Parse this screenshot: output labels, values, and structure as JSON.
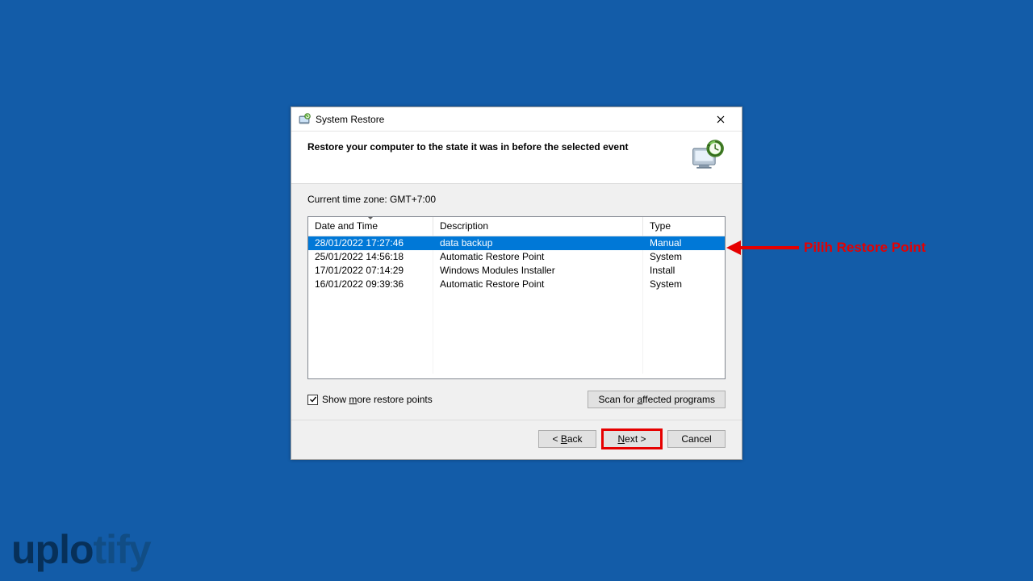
{
  "window": {
    "title": "System Restore"
  },
  "header": {
    "instruction": "Restore your computer to the state it was in before the selected event"
  },
  "content": {
    "timezone_label": "Current time zone: GMT+7:00",
    "columns": {
      "date": "Date and Time",
      "desc": "Description",
      "type": "Type"
    },
    "rows": [
      {
        "date": "28/01/2022 17:27:46",
        "desc": "data backup",
        "type": "Manual",
        "selected": true
      },
      {
        "date": "25/01/2022 14:56:18",
        "desc": "Automatic Restore Point",
        "type": "System",
        "selected": false
      },
      {
        "date": "17/01/2022 07:14:29",
        "desc": "Windows Modules Installer",
        "type": "Install",
        "selected": false
      },
      {
        "date": "16/01/2022 09:39:36",
        "desc": "Automatic Restore Point",
        "type": "System",
        "selected": false
      }
    ],
    "show_more": {
      "checked": true,
      "prefix": "Show ",
      "underlined": "m",
      "suffix": "ore restore points"
    },
    "scan_button": {
      "prefix": "Scan for ",
      "underlined": "a",
      "suffix": "ffected programs"
    }
  },
  "footer": {
    "back": {
      "prefix": "< ",
      "underlined": "B",
      "suffix": "ack"
    },
    "next": {
      "underlined": "N",
      "suffix": "ext >"
    },
    "cancel": "Cancel"
  },
  "annotations": {
    "arrow_label": "Pilih Restore Point",
    "highlight_color": "#e60000"
  },
  "watermark": {
    "part1": "uplo",
    "part2": "tify"
  }
}
